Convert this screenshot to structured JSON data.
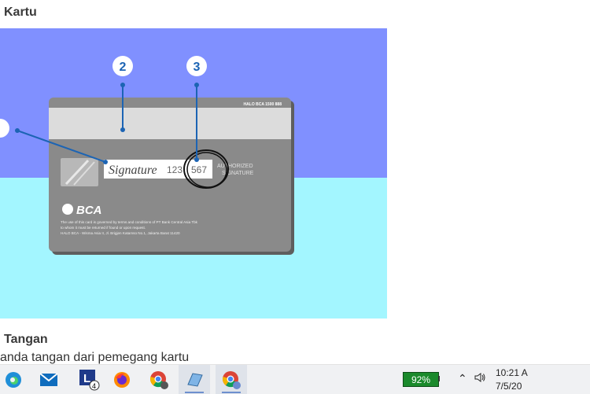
{
  "article": {
    "heading_top": "Kartu",
    "heading_bottom": "Tangan",
    "paragraph": "anda tangan dari pemegang kartu"
  },
  "card": {
    "header_text": "HALO BCA 1500 888",
    "signature_script": "Signature",
    "signature_digits": "123",
    "cvv": "567",
    "authorized_line1": "AUTHORIZED",
    "authorized_line2": "SIGNATURE",
    "bank_logo": "BCA",
    "legal_line1": "The use of this card is governed by terms and conditions of PT Bank Central Asia Tbk",
    "legal_line2": "to whom it must be returned if found or upon request.",
    "legal_line3": "HALO BCA - Wisma Asia II, Jl. Brigjen Katamso No.1, Jakarta Barat 11420"
  },
  "callouts": {
    "two": "2",
    "three": "3"
  },
  "taskbar": {
    "apps": [
      {
        "name": "edge-icon"
      },
      {
        "name": "mail-icon"
      },
      {
        "name": "app-l-icon",
        "label": "L",
        "badge": "4"
      },
      {
        "name": "firefox-icon"
      },
      {
        "name": "chrome-icon"
      },
      {
        "name": "notepad-icon"
      },
      {
        "name": "chrome-active-icon"
      }
    ],
    "battery": "92%",
    "time": "10:21 A",
    "date": "7/5/20"
  },
  "colors": {
    "illustration_top": "#8090ff",
    "illustration_bottom": "#a3f6ff",
    "card": "#8a8a8a",
    "stripe": "#dcdcdc",
    "callout_line": "#1c64b4"
  }
}
